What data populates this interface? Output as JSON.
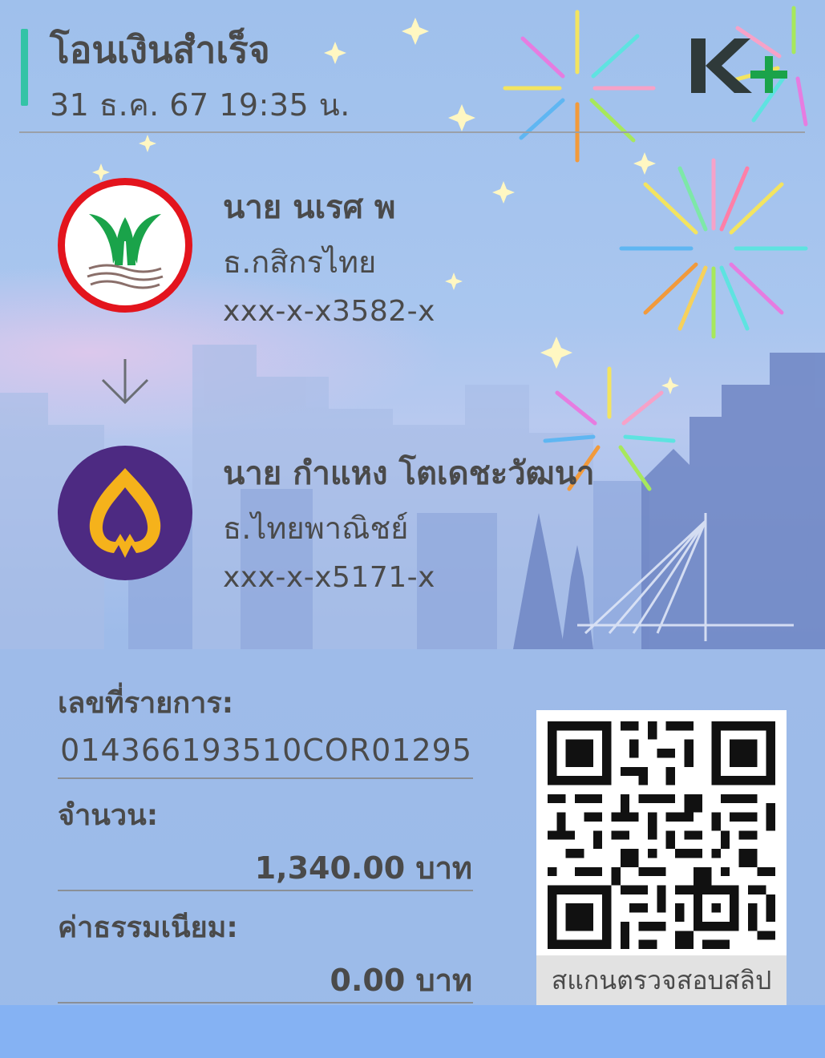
{
  "header": {
    "title": "โอนเงินสำเร็จ",
    "datetime": "31 ธ.ค. 67  19:35 น.",
    "brand_logo": "K+",
    "accent_color": "#34c3a6"
  },
  "sender": {
    "name": "นาย นเรศ พ",
    "bank": "ธ.กสิกรไทย",
    "account": "xxx-x-x3582-x",
    "logo_icon": "kbank-logo-icon"
  },
  "arrow_icon": "arrow-down-icon",
  "receiver": {
    "name": "นาย กำแหง โตเดชะวัฒนา",
    "bank": "ธ.ไทยพาณิชย์",
    "account": "xxx-x-x5171-x",
    "logo_icon": "scb-logo-icon"
  },
  "details": {
    "ref_label": "เลขที่รายการ:",
    "ref_value": "014366193510COR01295",
    "amount_label": "จำนวน:",
    "amount_value": "1,340.00 บาท",
    "fee_label": "ค่าธรรมเนียม:",
    "fee_value": "0.00 บาท"
  },
  "qr": {
    "caption": "สแกนตรวจสอบสลิป",
    "icon": "qr-code-icon"
  },
  "colors": {
    "kbank_green": "#1aa34a",
    "kbank_red": "#e3141d",
    "scb_purple": "#4d2a82",
    "scb_gold": "#f5b21b",
    "bottom_band": "#85b2f3"
  }
}
